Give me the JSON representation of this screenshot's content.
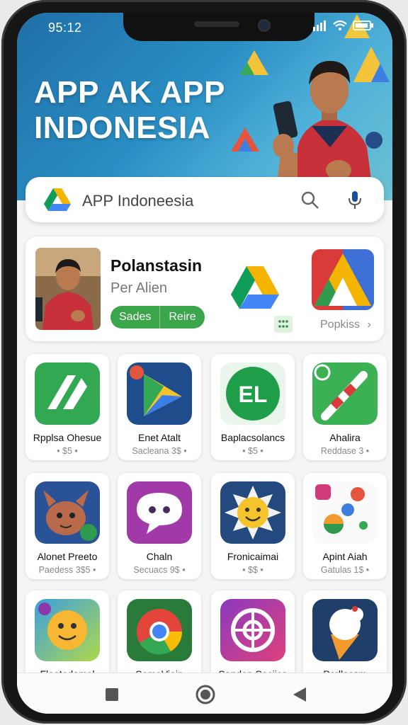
{
  "status": {
    "time": "95:12"
  },
  "hero": {
    "title_line1": "APP AK APP",
    "title_line2": "INDONESIA"
  },
  "search": {
    "text": "APP Indoneesia"
  },
  "featured": {
    "title": "Polanstasin",
    "subtitle": "Per Alien",
    "button_left": "Sades",
    "button_right": "Reire",
    "side_link": "Popkiss"
  },
  "apps": [
    {
      "name": "Rpplsa Ohesue",
      "sub": "• $5 •"
    },
    {
      "name": "Enet Atalt",
      "sub": "Sacleana 3$ •"
    },
    {
      "name": "Baplacsolancs",
      "sub": "• $5 •"
    },
    {
      "name": "Ahalira",
      "sub": "Reddase 3 •"
    },
    {
      "name": "Alonet Preeto",
      "sub": "Paedess 3$5 •"
    },
    {
      "name": "Chaln",
      "sub": "Secuacs 9$ •"
    },
    {
      "name": "Fronicaimai",
      "sub": "• $$ •"
    },
    {
      "name": "Apint Aiah",
      "sub": "Gatulas 1$ •"
    },
    {
      "name": "Flootedamol",
      "sub": ""
    },
    {
      "name": "SemoVioin",
      "sub": ""
    },
    {
      "name": "Sandon Sociica",
      "sub": ""
    },
    {
      "name": "Perllacsm",
      "sub": ""
    }
  ],
  "icons": [
    "signal-icon",
    "wifi-icon",
    "battery-icon",
    "drive-logo-icon",
    "search-icon",
    "mic-icon",
    "chevron-right-icon",
    "grid-icon",
    "square-nav-icon",
    "circle-nav-icon",
    "back-nav-icon"
  ],
  "colors": {
    "accent_green": "#3aa54a",
    "hero_blue": "#1f6fa8"
  }
}
